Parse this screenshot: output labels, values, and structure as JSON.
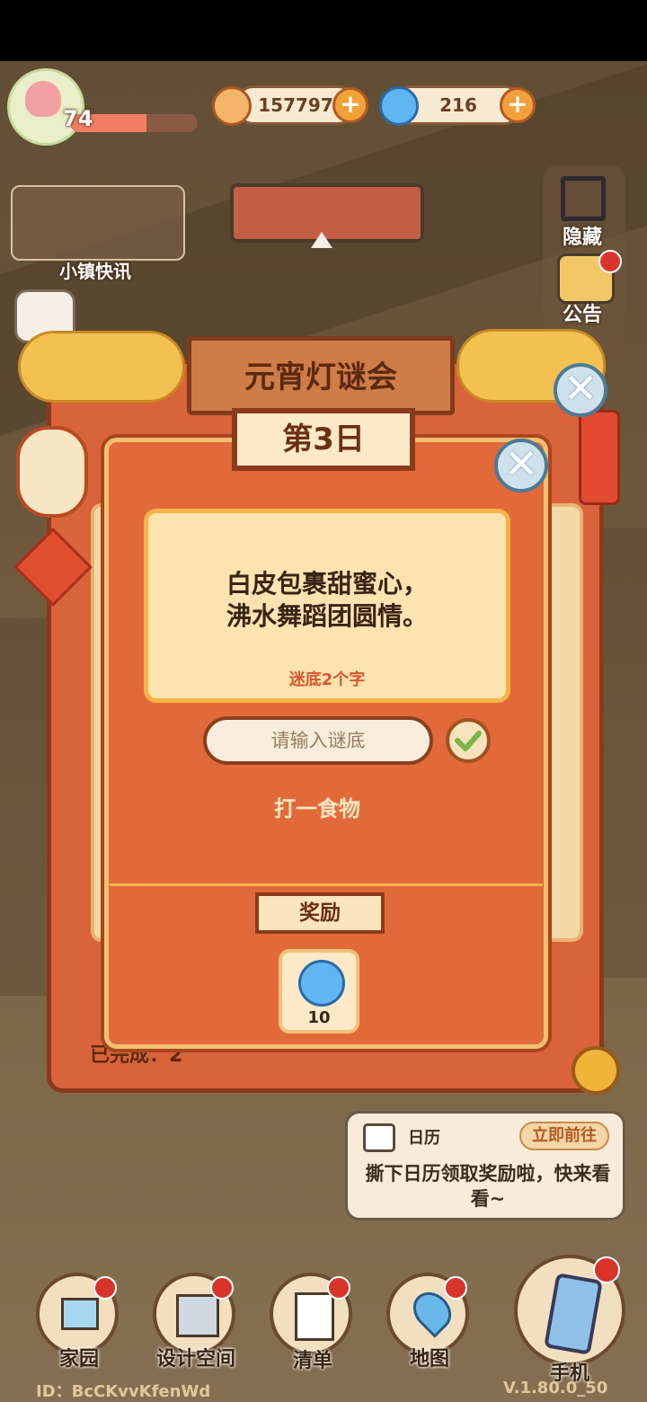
{
  "hud": {
    "level": "74",
    "currency1": "157797",
    "currency2": "216",
    "plus": "+"
  },
  "side": {
    "hide": "隐藏",
    "notice": "公告",
    "news": "小镇快讯"
  },
  "event": {
    "title": "元宵灯谜会",
    "day": "第3日",
    "riddle_line1": "白皮包裹甜蜜心，",
    "riddle_line2": "沸水舞蹈团圆情。",
    "hint": "迷底2个字",
    "answer_placeholder": "请输入谜底",
    "category": "打一食物",
    "reward_label": "奖励",
    "reward_count": "10",
    "close_symbol": "✕",
    "behind_completed": "已完成：2"
  },
  "notification": {
    "title": "日历",
    "goto": "立即前往",
    "body": "撕下日历领取奖励啦，快来看看~"
  },
  "nav": {
    "home": "家园",
    "design": "设计空间",
    "list": "清单",
    "map": "地图",
    "phone": "手机"
  },
  "footer": {
    "id": "ID：BcCKvvKfenWd",
    "version": "V.1.80.0_50"
  },
  "colors": {
    "accent": "#e26a3a",
    "frame": "#8b3a1e",
    "gold": "#f4b448"
  }
}
